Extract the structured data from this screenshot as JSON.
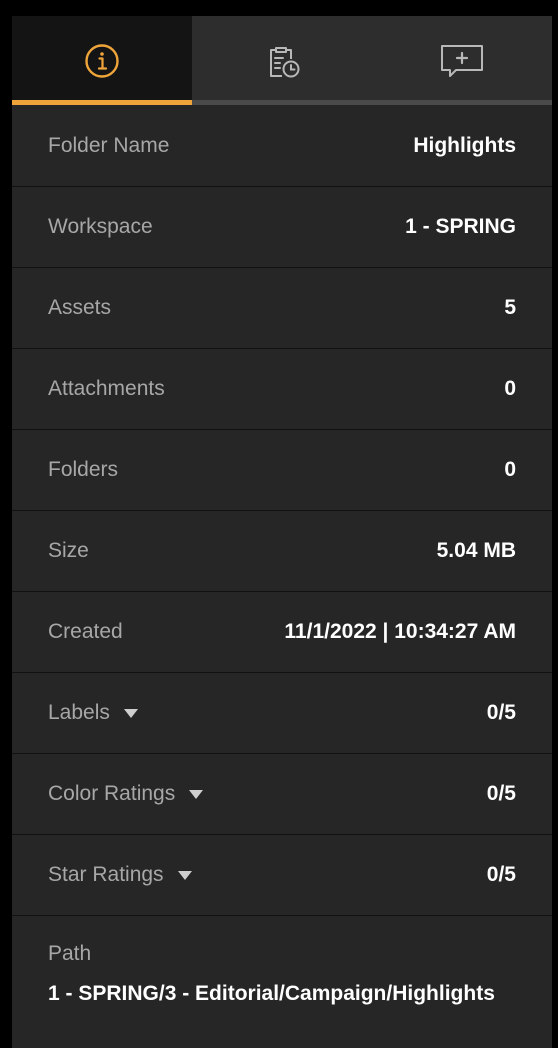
{
  "tabs": [
    {
      "icon": "info-icon",
      "active": true
    },
    {
      "icon": "clipboard-clock-icon",
      "active": false
    },
    {
      "icon": "comment-add-icon",
      "active": false
    }
  ],
  "colors": {
    "accent": "#f0a53a",
    "panel_bg": "#262626",
    "label": "#a7a7a7",
    "value": "#ffffff"
  },
  "details": {
    "folder_name": {
      "label": "Folder Name",
      "value": "Highlights"
    },
    "workspace": {
      "label": "Workspace",
      "value": "1 - SPRING"
    },
    "assets": {
      "label": "Assets",
      "value": "5"
    },
    "attachments": {
      "label": "Attachments",
      "value": "0"
    },
    "folders": {
      "label": "Folders",
      "value": "0"
    },
    "size": {
      "label": "Size",
      "value": "5.04 MB"
    },
    "created": {
      "label": "Created",
      "value": "11/1/2022 | 10:34:27 AM"
    },
    "labels": {
      "label": "Labels",
      "value": "0/5"
    },
    "color_ratings": {
      "label": "Color Ratings",
      "value": "0/5"
    },
    "star_ratings": {
      "label": "Star Ratings",
      "value": "0/5"
    },
    "path": {
      "label": "Path",
      "value": "1 - SPRING/3 - Editorial/Campaign/Highlights"
    }
  }
}
